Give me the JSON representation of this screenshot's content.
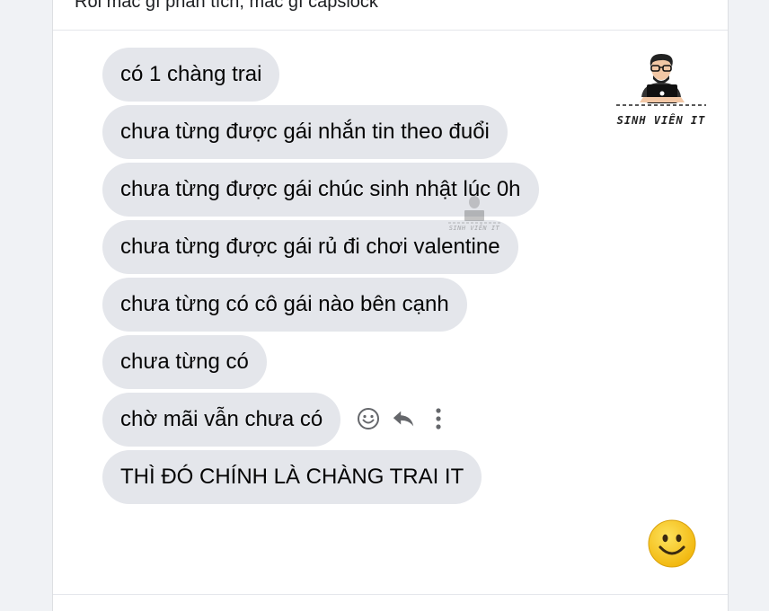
{
  "post": {
    "text": "Rồi mắc gì phân tích, mắc gì capslock"
  },
  "messages": [
    {
      "text": "có 1 chàng trai"
    },
    {
      "text": "chưa từng được gái nhắn tin theo đuổi"
    },
    {
      "text": "chưa từng được gái chúc sinh nhật lúc 0h"
    },
    {
      "text": "chưa từng được gái rủ đi chơi valentine"
    },
    {
      "text": "chưa từng có cô gái nào bên cạnh"
    },
    {
      "text": "chưa từng có"
    },
    {
      "text": "chờ mãi vẫn chưa có"
    },
    {
      "text": "THÌ ĐÓ CHÍNH LÀ CHÀNG TRAI IT"
    }
  ],
  "message_actions": [
    {
      "icon": "smiley-react-icon"
    },
    {
      "icon": "reply-icon"
    },
    {
      "icon": "more-options-icon"
    }
  ],
  "logo": {
    "text": "SINH VIÊN IT"
  },
  "watermark": {
    "text": "SINH VIÊN IT"
  },
  "emoji": {
    "icon": "slightly-smiling-face-icon"
  },
  "colors": {
    "bubble": "#e4e6eb",
    "page_background": "#f0f2f5",
    "emoji": "#f7c51d"
  }
}
